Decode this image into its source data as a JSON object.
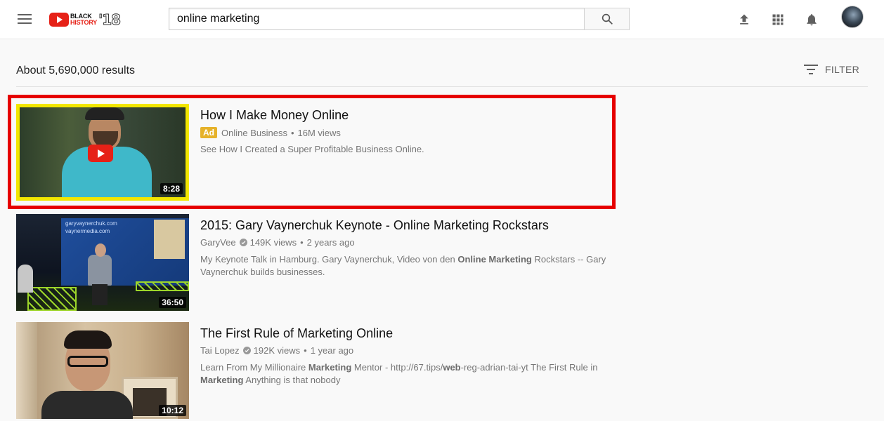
{
  "header": {
    "logo": {
      "line1": "BLACK",
      "line2": "HISTORY",
      "year": "'18"
    },
    "search": {
      "value": "online marketing",
      "placeholder": "Search"
    }
  },
  "results": {
    "count_text": "About 5,690,000 results",
    "filter_label": "FILTER"
  },
  "videos": [
    {
      "title": "How I Make Money Online",
      "is_ad": true,
      "ad_label": "Ad",
      "channel": "Online Business",
      "views": "16M views",
      "age": "",
      "desc_plain": "See How I Created a Super Profitable Business Online.",
      "duration": "8:28"
    },
    {
      "title": "2015: Gary Vaynerchuk Keynote - Online Marketing Rockstars",
      "channel": "GaryVee",
      "views": "149K views",
      "age": "2 years ago",
      "desc_pre": "My Keynote Talk in Hamburg. Gary Vaynerchuk, Video von den ",
      "desc_bold": "Online Marketing",
      "desc_post": " Rockstars -- Gary Vaynerchuk builds businesses.",
      "duration": "36:50",
      "thumb_text": "garyvaynerchuk.com\nvaynermedia.com\n/gary\n@garyvee"
    },
    {
      "title": "The First Rule of Marketing Online",
      "channel": "Tai Lopez",
      "views": "192K views",
      "age": "1 year ago",
      "desc_p1": "Learn From My Millionaire ",
      "desc_b1": "Marketing",
      "desc_p2": " Mentor - http://67.tips/",
      "desc_b2": "web",
      "desc_p3": "-reg-adrian-tai-yt The First Rule in ",
      "desc_b3": "Marketing",
      "desc_p4": " Anything is that nobody",
      "duration": "10:12"
    }
  ],
  "separator": "•",
  "colors": {
    "youtube_red": "#e62117",
    "ad_badge": "#e6b22a",
    "highlight_box": "#e60000"
  }
}
